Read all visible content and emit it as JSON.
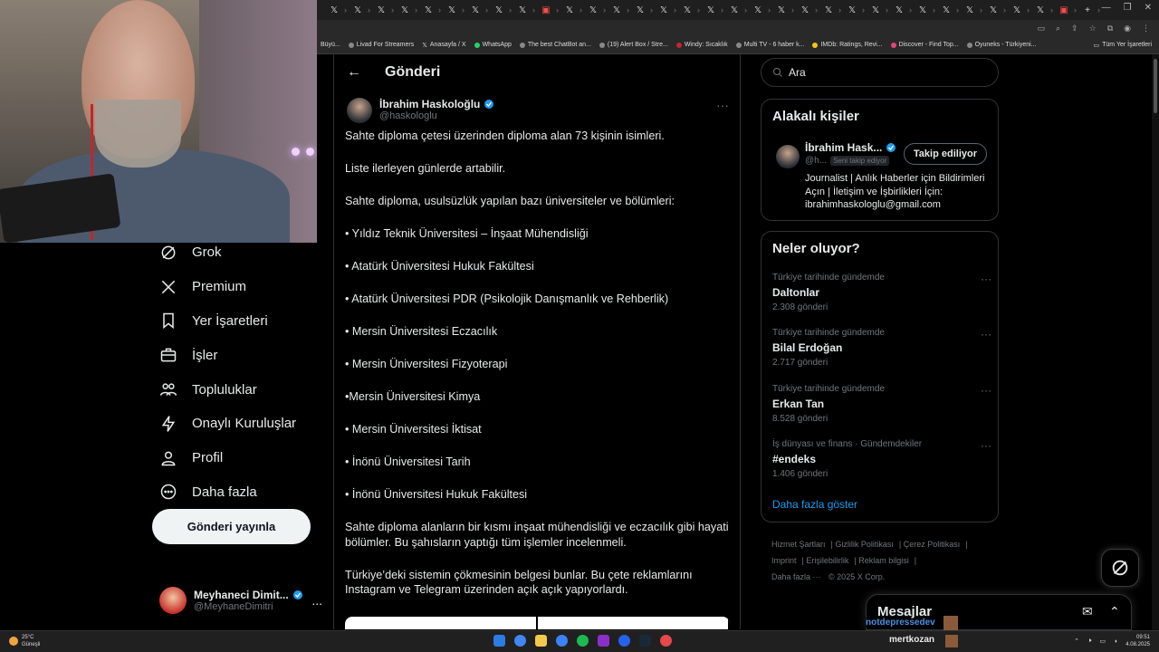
{
  "browser": {
    "bookmarks": [
      "Büyü...",
      "Livad For Streamers",
      "Anasayfa / X",
      "WhatsApp",
      "The best ChatBot an...",
      "(19) Alert Box / Stre...",
      "Windy: Sıcaklık",
      "Multi TV - 6 haber k...",
      "IMDb: Ratings, Revi...",
      "Discover - Find Top...",
      "Oyuneks - Türkiyeni..."
    ],
    "all_bookmarks": "Tüm Yer İşaretleri"
  },
  "nav": {
    "items": [
      {
        "label": "Grok"
      },
      {
        "label": "Premium"
      },
      {
        "label": "Yer İşaretleri"
      },
      {
        "label": "İşler"
      },
      {
        "label": "Topluluklar"
      },
      {
        "label": "Onaylı Kuruluşlar"
      },
      {
        "label": "Profil"
      },
      {
        "label": "Daha fazla"
      }
    ],
    "post_button": "Gönderi yayınla",
    "account": {
      "name": "Meyhaneci Dimit...",
      "handle": "@MeyhaneDimitri",
      "more": "..."
    }
  },
  "main": {
    "back": "←",
    "title": "Gönderi",
    "author": {
      "name": "İbrahim Haskoloğlu",
      "handle": "@haskologlu",
      "more": "···"
    },
    "paragraphs": [
      "Sahte diploma çetesi üzerinden diploma alan 73 kişinin isimleri.",
      "Liste ilerleyen günlerde artabilir.",
      "Sahte diploma, usulsüzlük yapılan bazı üniversiteler ve bölümleri:",
      "• Yıldız Teknik Üniversitesi – İnşaat Mühendisliği",
      "• Atatürk Üniversitesi Hukuk Fakültesi",
      "• Atatürk Üniversitesi PDR (Psikolojik Danışmanlık ve Rehberlik)",
      "• Mersin Üniversitesi Eczacılık",
      "• Mersin Üniversitesi Fizyoterapi",
      "•Mersin Üniversitesi Kimya",
      "• Mersin Üniversitesi İktisat",
      "• İnönü Üniversitesi Tarih",
      "• İnönü Üniversitesi Hukuk Fakültesi",
      "Sahte diploma alanların bir kısmı inşaat mühendisliği ve eczacılık gibi hayati bölümler. Bu şahısların yaptığı tüm işlemler incelenmeli.",
      "Türkiye’deki sistemin çökmesinin belgesi bunlar. Bu çete reklamlarını Instagram ve Telegram üzerinden açık açık yapıyorlardı."
    ]
  },
  "right": {
    "search_placeholder": "Ara",
    "related": {
      "title": "Alakalı kişiler",
      "name": "İbrahim Hask...",
      "handle": "@h...",
      "follows_you": "Seni takip ediyor",
      "follow_button": "Takip ediliyor",
      "bio": "Journalist | Anlık Haberler için Bildirimleri Açın | İletişim ve İşbirlikleri İçin: ibrahimhaskologlu@gmail.com"
    },
    "trends": {
      "title": "Neler oluyor?",
      "items": [
        {
          "context": "Türkiye tarihinde gündemde",
          "topic": "Daltonlar",
          "count": "2.308 gönderi"
        },
        {
          "context": "Türkiye tarihinde gündemde",
          "topic": "Bilal Erdoğan",
          "count": "2.717 gönderi"
        },
        {
          "context": "Türkiye tarihinde gündemde",
          "topic": "Erkan Tan",
          "count": "8.528 gönderi"
        },
        {
          "context": "İş dünyası ve finans · Gündemdekiler",
          "topic": "#endeks",
          "count": "1.406 gönderi"
        }
      ],
      "show_more": "Daha fazla göster"
    },
    "footer": {
      "links": [
        "Hizmet Şartları",
        "Gizlilik Politikası",
        "Çerez Politikası",
        "Imprint",
        "Erişilebilirlik",
        "Reklam bilgisi",
        "Daha fazla ···"
      ],
      "copyright": "© 2025 X Corp."
    },
    "messages": {
      "title": "Mesajlar"
    },
    "overlay_name": "notdepressedev"
  },
  "taskbar": {
    "temp": "25°C",
    "weather": "Güneşli",
    "streamer": "mertkozan",
    "time": "09:51",
    "date": "4.08.2025"
  },
  "colors": {
    "accent": "#1d9bf0",
    "bg": "#000000",
    "text": "#e7e9ea",
    "muted": "#71767b",
    "border": "#2f3336"
  }
}
